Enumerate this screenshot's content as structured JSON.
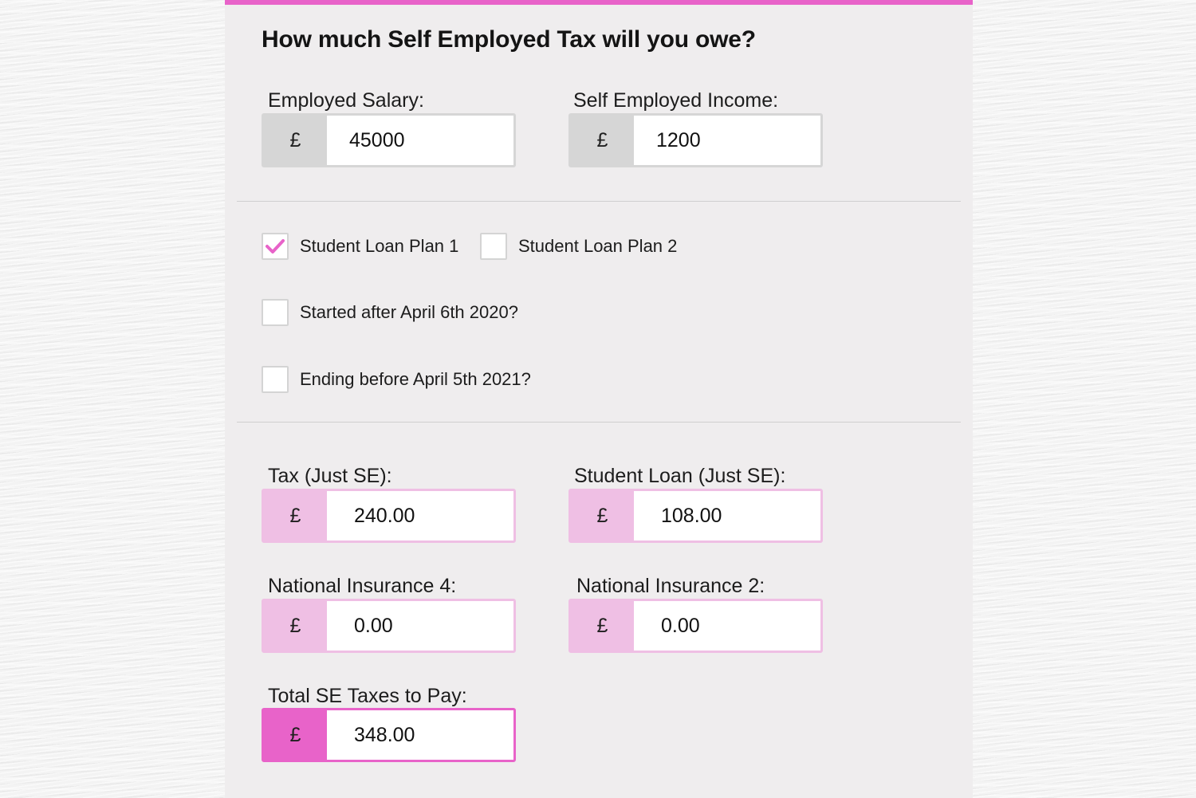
{
  "title": "How much Self Employed Tax will you owe?",
  "currency_symbol": "£",
  "inputs": {
    "employed_salary": {
      "label": "Employed Salary:",
      "value": "45000"
    },
    "self_employed_income": {
      "label": "Self Employed Income:",
      "value": "1200"
    }
  },
  "options": {
    "student_loan_plan_1": {
      "label": "Student Loan Plan 1",
      "checked": true
    },
    "student_loan_plan_2": {
      "label": "Student Loan Plan 2",
      "checked": false
    },
    "started_after": {
      "label": "Started after April 6th 2020?",
      "checked": false
    },
    "ending_before": {
      "label": "Ending before April 5th 2021?",
      "checked": false
    }
  },
  "results": {
    "tax_just_se": {
      "label": "Tax (Just SE):",
      "value": "240.00"
    },
    "student_loan_just_se": {
      "label": "Student Loan (Just SE):",
      "value": "108.00"
    },
    "national_insurance_4": {
      "label": "National Insurance 4:",
      "value": "0.00"
    },
    "national_insurance_2": {
      "label": "National Insurance 2:",
      "value": "0.00"
    },
    "total_se_taxes": {
      "label": "Total SE Taxes to Pay:",
      "value": "348.00"
    }
  },
  "colors": {
    "accent": "#e863c9",
    "accent_light": "#efbfe4",
    "prefix_gray": "#d6d6d6",
    "panel_background": "#efedee"
  },
  "icons": {
    "checkmark": "check-icon"
  }
}
